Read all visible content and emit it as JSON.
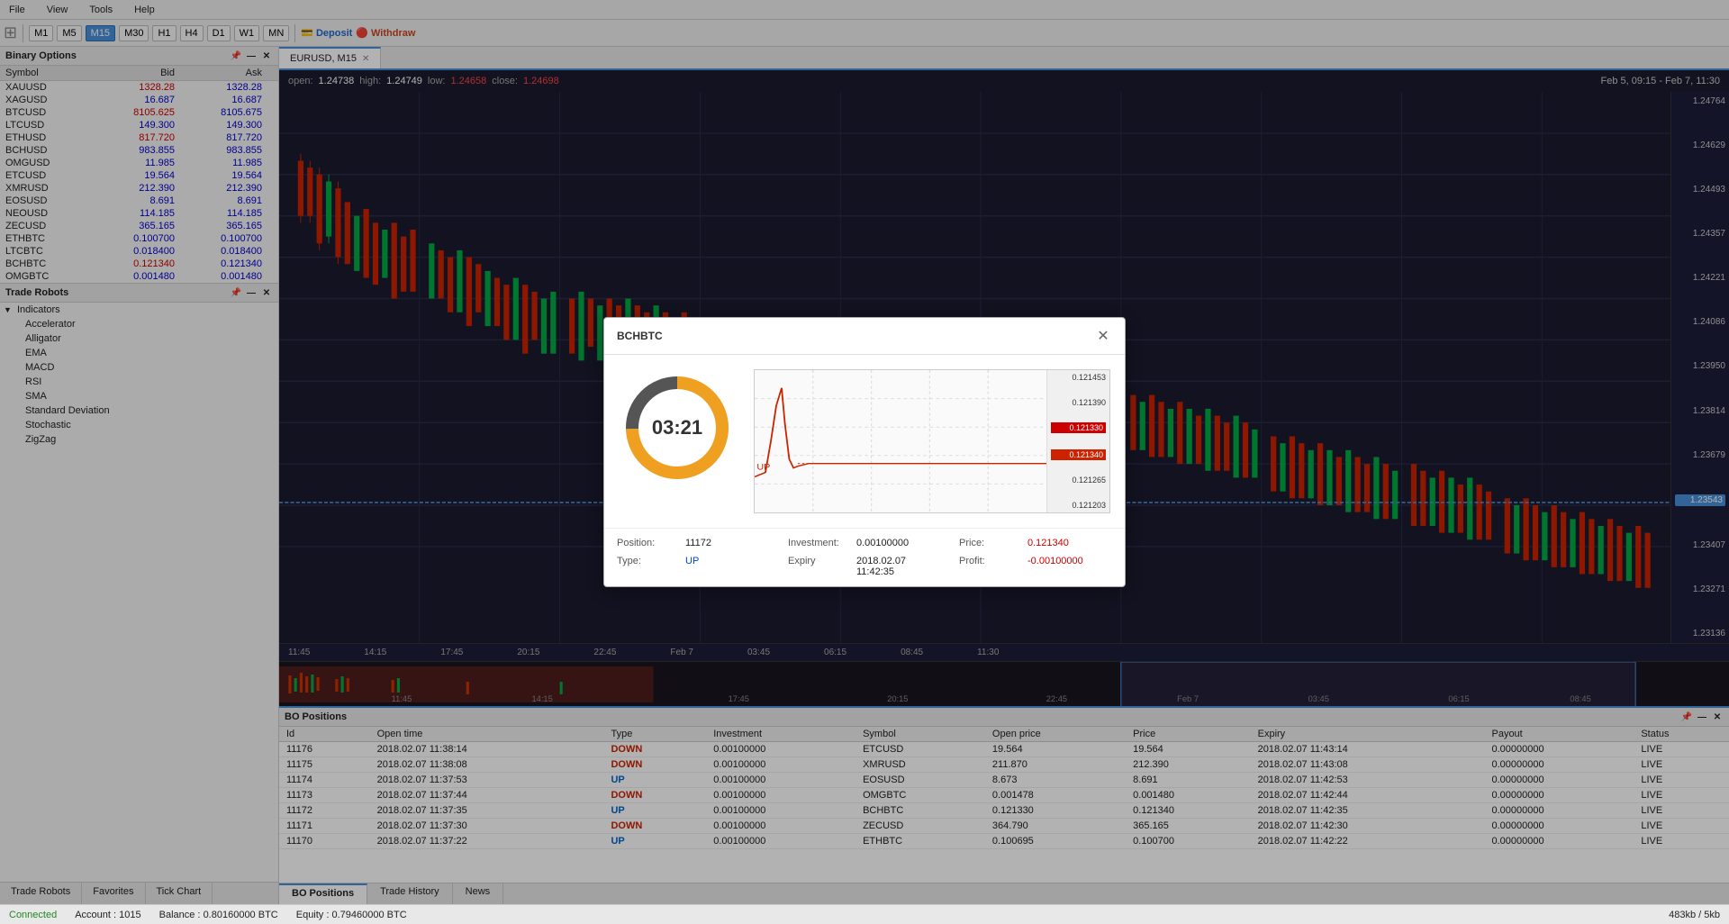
{
  "menu": {
    "items": [
      "File",
      "View",
      "Tools",
      "Help"
    ]
  },
  "toolbar": {
    "timeframes": [
      "M1",
      "M5",
      "M15",
      "M30",
      "H1",
      "H4",
      "D1",
      "W1",
      "MN"
    ],
    "active_tf": "M15",
    "deposit_label": "Deposit",
    "withdraw_label": "Withdraw"
  },
  "binary_options": {
    "title": "Binary Options",
    "columns": [
      "Symbol",
      "Bid",
      "Ask"
    ],
    "rows": [
      {
        "symbol": "XAUUSD",
        "bid": "1328.28",
        "ask": "1328.28",
        "bid_red": true
      },
      {
        "symbol": "XAGUSD",
        "bid": "16.687",
        "ask": "16.687",
        "bid_red": false
      },
      {
        "symbol": "BTCUSD",
        "bid": "8105.625",
        "ask": "8105.675",
        "bid_red": true
      },
      {
        "symbol": "LTCUSD",
        "bid": "149.300",
        "ask": "149.300",
        "bid_red": false
      },
      {
        "symbol": "ETHUSD",
        "bid": "817.720",
        "ask": "817.720",
        "bid_red": true
      },
      {
        "symbol": "BCHUSD",
        "bid": "983.855",
        "ask": "983.855",
        "bid_red": false
      },
      {
        "symbol": "OMGUSD",
        "bid": "11.985",
        "ask": "11.985",
        "bid_red": false
      },
      {
        "symbol": "ETCUSD",
        "bid": "19.564",
        "ask": "19.564",
        "bid_red": false
      },
      {
        "symbol": "XMRUSD",
        "bid": "212.390",
        "ask": "212.390",
        "bid_red": false
      },
      {
        "symbol": "EOSUSD",
        "bid": "8.691",
        "ask": "8.691",
        "bid_red": false
      },
      {
        "symbol": "NEOUSD",
        "bid": "114.185",
        "ask": "114.185",
        "bid_red": false
      },
      {
        "symbol": "ZECUSD",
        "bid": "365.165",
        "ask": "365.165",
        "bid_red": false
      },
      {
        "symbol": "ETHBTC",
        "bid": "0.100700",
        "ask": "0.100700",
        "bid_red": false
      },
      {
        "symbol": "LTCBTC",
        "bid": "0.018400",
        "ask": "0.018400",
        "bid_red": false
      },
      {
        "symbol": "BCHBTC",
        "bid": "0.121340",
        "ask": "0.121340",
        "bid_red": true
      },
      {
        "symbol": "OMGBTC",
        "bid": "0.001480",
        "ask": "0.001480",
        "bid_red": false
      }
    ]
  },
  "trade_robots": {
    "title": "Trade Robots",
    "indicators": {
      "label": "Indicators",
      "children": [
        "Accelerator",
        "Alligator",
        "EMA",
        "MACD",
        "RSI",
        "SMA",
        "Standard Deviation",
        "Stochastic",
        "ZigZag"
      ]
    }
  },
  "bottom_panel_tabs": [
    "Trade Robots",
    "Favorites",
    "Tick Chart"
  ],
  "chart": {
    "tab_label": "EURUSD, M15",
    "ohlc": {
      "open_label": "open:",
      "open_val": "1.24738",
      "high_label": "high:",
      "high_val": "1.24749",
      "low_label": "low:",
      "low_val": "1.24658",
      "close_label": "close:",
      "close_val": "1.24698"
    },
    "date_range": "Feb 5, 09:15 - Feb 7, 11:30",
    "price_levels": [
      "1.24764",
      "1.24629",
      "1.24493",
      "1.24357",
      "1.24221",
      "1.24086",
      "1.23950",
      "1.23814",
      "1.23679",
      "1.23543",
      "1.23407",
      "1.23271",
      "1.23136"
    ],
    "current_price": "1.23543",
    "time_labels": [
      "11:45",
      "14:15",
      "17:45",
      "20:15",
      "22:45",
      "Feb 7",
      "03:45",
      "06:15",
      "08:45",
      "11:30"
    ],
    "overview_time_labels": [
      "11:45",
      "14:15",
      "17:45",
      "20:15",
      "22:45",
      "Feb 7",
      "03:45",
      "06:15",
      "08:45"
    ]
  },
  "modal": {
    "title": "BCHBTC",
    "timer": "03:21",
    "position": "11172",
    "type": "UP",
    "investment_label": "Investment:",
    "investment_val": "0.00100000",
    "expiry_label": "Expiry",
    "expiry_val": "2018.02.07 11:42:35",
    "price_label": "Price:",
    "price_val": "0.121340",
    "profit_label": "Profit:",
    "profit_val": "-0.00100000",
    "mini_chart": {
      "price_levels": [
        "0.121453",
        "0.121390",
        "0.121330",
        "0.121265",
        "0.121203"
      ],
      "current_price": "0.121340",
      "up_label": "UP"
    }
  },
  "bo_positions": {
    "title": "BO Positions",
    "columns": [
      "Id",
      "Open time",
      "Type",
      "Investment",
      "Symbol",
      "Open price",
      "Price",
      "Expiry",
      "Payout",
      "Status"
    ],
    "rows": [
      {
        "id": "11176",
        "open_time": "2018.02.07 11:38:14",
        "type": "DOWN",
        "investment": "0.00100000",
        "symbol": "ETCUSD",
        "open_price": "19.564",
        "price": "19.564",
        "expiry": "2018.02.07 11:43:14",
        "payout": "0.00000000",
        "status": "LIVE"
      },
      {
        "id": "11175",
        "open_time": "2018.02.07 11:38:08",
        "type": "DOWN",
        "investment": "0.00100000",
        "symbol": "XMRUSD",
        "open_price": "211.870",
        "price": "212.390",
        "expiry": "2018.02.07 11:43:08",
        "payout": "0.00000000",
        "status": "LIVE"
      },
      {
        "id": "11174",
        "open_time": "2018.02.07 11:37:53",
        "type": "UP",
        "investment": "0.00100000",
        "symbol": "EOSUSD",
        "open_price": "8.673",
        "price": "8.691",
        "expiry": "2018.02.07 11:42:53",
        "payout": "0.00000000",
        "status": "LIVE"
      },
      {
        "id": "11173",
        "open_time": "2018.02.07 11:37:44",
        "type": "DOWN",
        "investment": "0.00100000",
        "symbol": "OMGBTC",
        "open_price": "0.001478",
        "price": "0.001480",
        "expiry": "2018.02.07 11:42:44",
        "payout": "0.00000000",
        "status": "LIVE"
      },
      {
        "id": "11172",
        "open_time": "2018.02.07 11:37:35",
        "type": "UP",
        "investment": "0.00100000",
        "symbol": "BCHBTC",
        "open_price": "0.121330",
        "price": "0.121340",
        "expiry": "2018.02.07 11:42:35",
        "payout": "0.00000000",
        "status": "LIVE"
      },
      {
        "id": "11171",
        "open_time": "2018.02.07 11:37:30",
        "type": "DOWN",
        "investment": "0.00100000",
        "symbol": "ZECUSD",
        "open_price": "364.790",
        "price": "365.165",
        "expiry": "2018.02.07 11:42:30",
        "payout": "0.00000000",
        "status": "LIVE"
      },
      {
        "id": "11170",
        "open_time": "2018.02.07 11:37:22",
        "type": "UP",
        "investment": "0.00100000",
        "symbol": "ETHBTC",
        "open_price": "0.100695",
        "price": "0.100700",
        "expiry": "2018.02.07 11:42:22",
        "payout": "0.00000000",
        "status": "LIVE"
      }
    ],
    "tabs": [
      "BO Positions",
      "Trade History",
      "News"
    ],
    "active_tab": "BO Positions"
  },
  "status_bar": {
    "connected": "Connected",
    "account_label": "Account :",
    "account_val": "1015",
    "balance_label": "Balance :",
    "balance_val": "0.80160000 BTC",
    "equity_label": "Equity :",
    "equity_val": "0.79460000 BTC",
    "memory": "483kb / 5kb"
  }
}
